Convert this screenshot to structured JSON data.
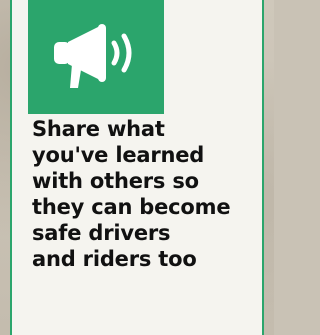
{
  "card": {
    "icon": "megaphone-icon",
    "message_lines": [
      "Share what",
      "you've learned",
      "with others so",
      "they can become",
      "safe drivers",
      "and riders too"
    ]
  },
  "colors": {
    "accent": "#2ba56c",
    "card_background": "#f5f4ef",
    "text": "#111111"
  }
}
